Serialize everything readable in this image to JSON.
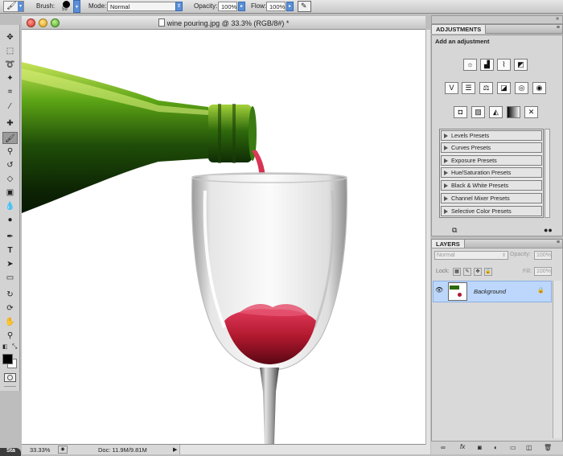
{
  "options_bar": {
    "brush_label": "Brush:",
    "brush_size": "59",
    "mode_label": "Mode:",
    "mode_value": "Normal",
    "opacity_label": "Opacity:",
    "opacity_value": "100%",
    "flow_label": "Flow:",
    "flow_value": "100%"
  },
  "document": {
    "title": "wine pouring.jpg @ 33.3% (RGB/8#) *",
    "zoom": "33.33%",
    "doc_info": "Doc: 11.9M/9.81M"
  },
  "adjustments": {
    "tab": "ADJUSTMENTS",
    "heading": "Add an adjustment",
    "presets": [
      "Levels Presets",
      "Curves Presets",
      "Exposure Presets",
      "Hue/Saturation Presets",
      "Black & White Presets",
      "Channel Mixer Presets",
      "Selective Color Presets"
    ]
  },
  "layers": {
    "tab": "LAYERS",
    "blend_mode": "Normal",
    "opacity_label": "Opacity:",
    "opacity_value": "100%",
    "lock_label": "Lock:",
    "fill_label": "Fill:",
    "fill_value": "100%",
    "layer_name": "Background"
  },
  "dock": {
    "label": "Sta"
  },
  "colors": {
    "foreground": "#000000",
    "background": "#ffffff",
    "layer_selected": "#bcd7fb",
    "wine": "#b0182e",
    "bottle": "#3d8a12"
  }
}
